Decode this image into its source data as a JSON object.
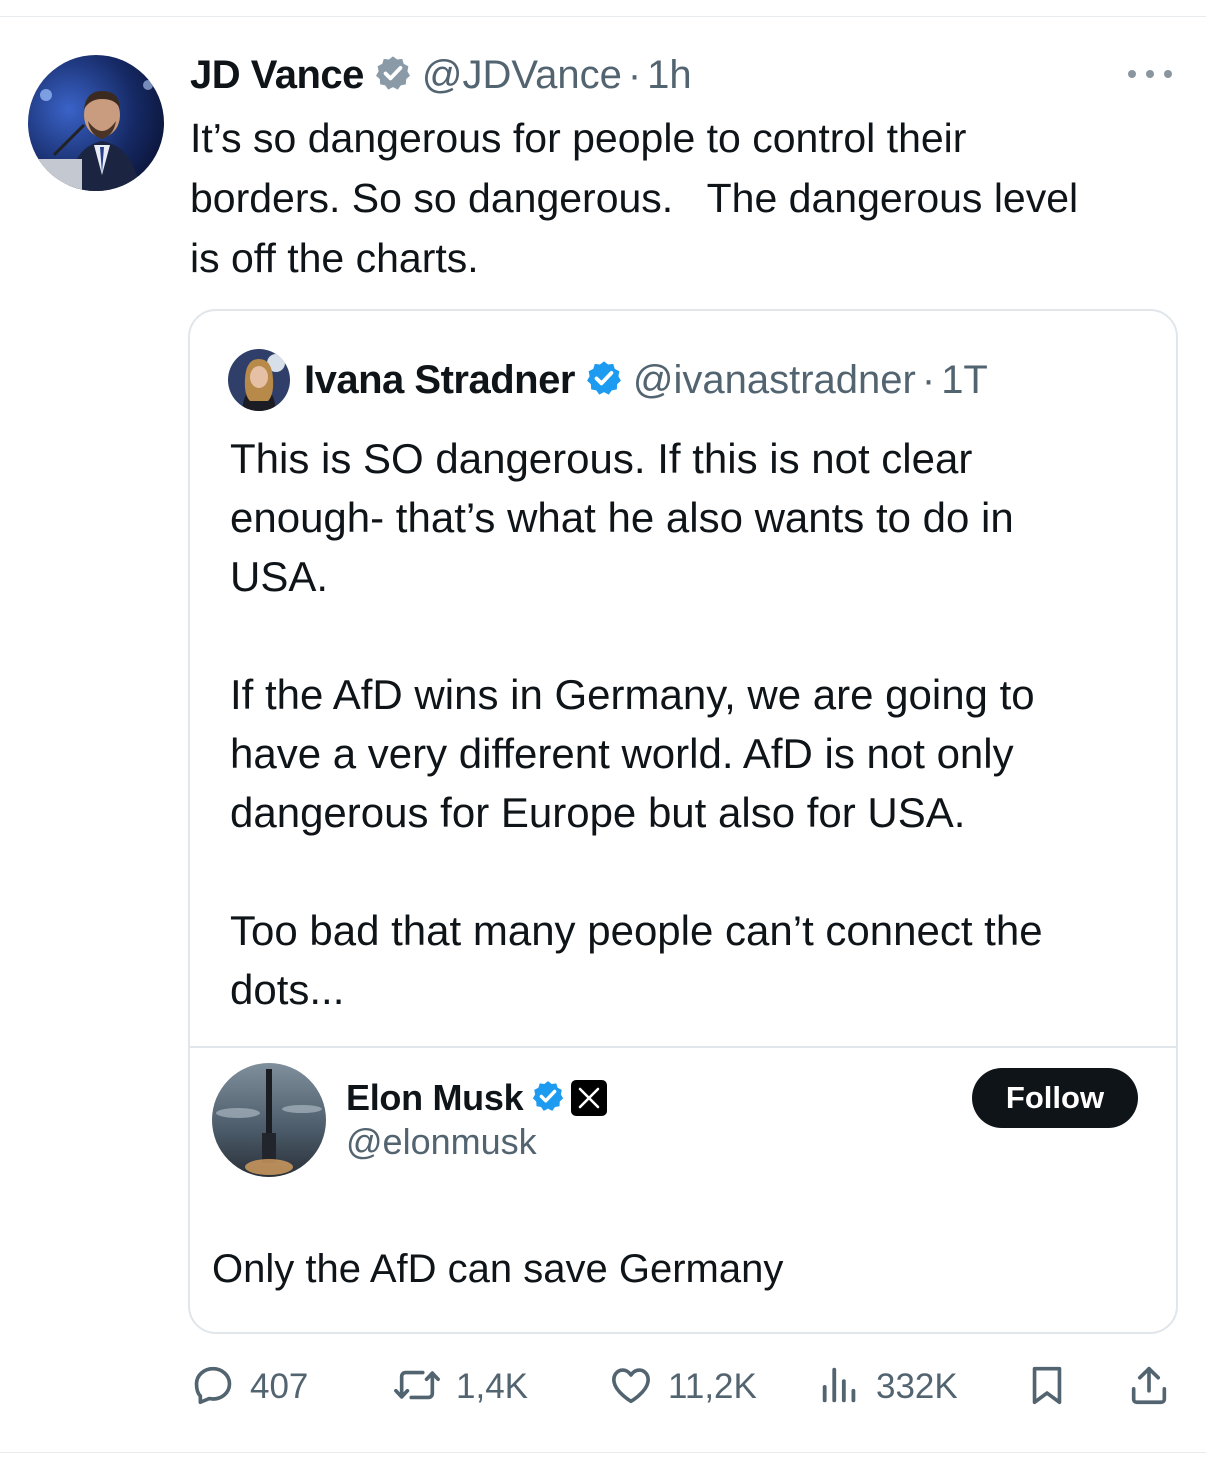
{
  "tweet": {
    "author_name": "JD Vance",
    "handle": "@JDVance",
    "separator": "·",
    "time": "1h",
    "text": "It’s so dangerous for people to control their\nborders. So so dangerous.   The dangerous level\nis off the charts."
  },
  "quoted_tweet": {
    "author_name": "Ivana Stradner",
    "handle": "@ivanastradner",
    "separator": "·",
    "time": "1T",
    "text": "This is SO dangerous. If this is not clear\nenough- that’s what he also wants to do in\nUSA.\n\nIf the AfD wins in Germany, we are going to\nhave a very different world. AfD is not only\ndangerous for Europe but also for USA.\n\nToo bad that many people can’t connect the\ndots..."
  },
  "embedded_post": {
    "author_name": "Elon Musk",
    "handle": "@elonmusk",
    "follow_label": "Follow",
    "text": "Only the AfD can save Germany"
  },
  "actions": {
    "replies": "407",
    "reposts": "1,4K",
    "likes": "11,2K",
    "views": "332K"
  },
  "colors": {
    "verified_blue": "#1d9bf0",
    "secondary_text": "#536471",
    "border": "#e1e6ea"
  },
  "icons": [
    "verified-badge-icon",
    "more-icon",
    "x-logo-icon",
    "reply-icon",
    "repost-icon",
    "like-icon",
    "views-icon",
    "bookmark-icon",
    "share-icon"
  ]
}
